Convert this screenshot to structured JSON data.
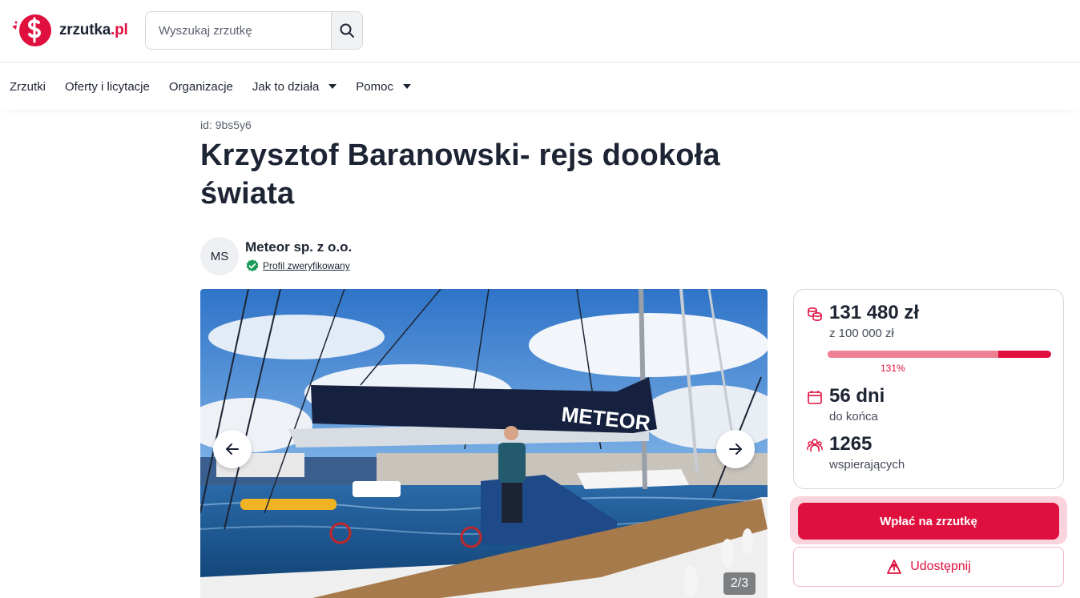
{
  "brand": {
    "name": "zrzutka",
    "tld": ".pl",
    "accent": "#e0103e"
  },
  "search": {
    "placeholder": "Wyszukaj zrzutkę",
    "icon": "search-icon"
  },
  "nav": {
    "items": [
      {
        "label": "Zrzutki",
        "has_dropdown": false
      },
      {
        "label": "Oferty i licytacje",
        "has_dropdown": false
      },
      {
        "label": "Organizacje",
        "has_dropdown": false
      },
      {
        "label": "Jak to działa",
        "has_dropdown": true
      },
      {
        "label": "Pomoc",
        "has_dropdown": true
      }
    ]
  },
  "campaign": {
    "id_label": "id: 9bs5y6",
    "title": "Krzysztof Baranowski- rejs dookoła świata",
    "organizer": {
      "initials": "MS",
      "name": "Meteor sp. z o.o.",
      "verified_label": "Profil zweryfikowany",
      "verified_icon": "verified-check-icon"
    },
    "gallery": {
      "counter": "2/3",
      "prev_icon": "arrow-left-icon",
      "next_icon": "arrow-right-icon"
    }
  },
  "stats": {
    "raised": "131 480 zł",
    "goal": "z 100 000 zł",
    "progress_percent_label": "131%",
    "progress_fraction": 1.31,
    "days": "56 dni",
    "days_sub": "do końca",
    "supporters": "1265",
    "supporters_sub": "wspierających",
    "icons": [
      "coins-icon",
      "calendar-icon",
      "people-icon"
    ]
  },
  "actions": {
    "donate_label": "Wpłać na zrzutkę",
    "share_label": "Udostępnij",
    "share_icon": "share-icon"
  }
}
